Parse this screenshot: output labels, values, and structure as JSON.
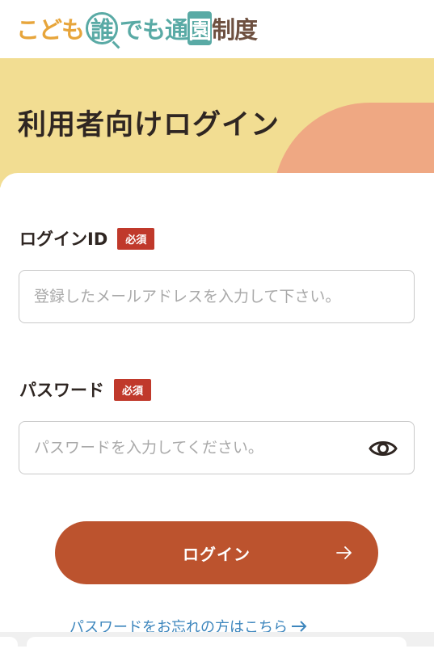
{
  "logo": {
    "part_1": "こども",
    "circle": "誰",
    "part_2": "でも通",
    "circle_2": "園",
    "part_3": "制度"
  },
  "page_title": "利用者向けログイン",
  "form": {
    "login_id": {
      "label": "ログインID",
      "required_badge": "必須",
      "placeholder": "登録したメールアドレスを入力して下さい。",
      "value": ""
    },
    "password": {
      "label": "パスワード",
      "required_badge": "必須",
      "placeholder": "パスワードを入力してください。",
      "value": "",
      "toggle_icon": "eye-icon"
    },
    "login_button": {
      "label": "ログイン",
      "icon": "arrow-right-icon"
    },
    "forgot_link": "パスワードをお忘れの方はこちら",
    "forgot_icon": "arrow-right-icon"
  },
  "colors": {
    "hero_yellow": "#f2dd92",
    "hero_peach": "#efa883",
    "required_red": "#c0392b",
    "button_orange": "#bc532e",
    "logo_orange": "#e7a53b",
    "logo_teal": "#59aaa5",
    "logo_brown": "#6e5040",
    "link_blue": "#3d86bd"
  }
}
